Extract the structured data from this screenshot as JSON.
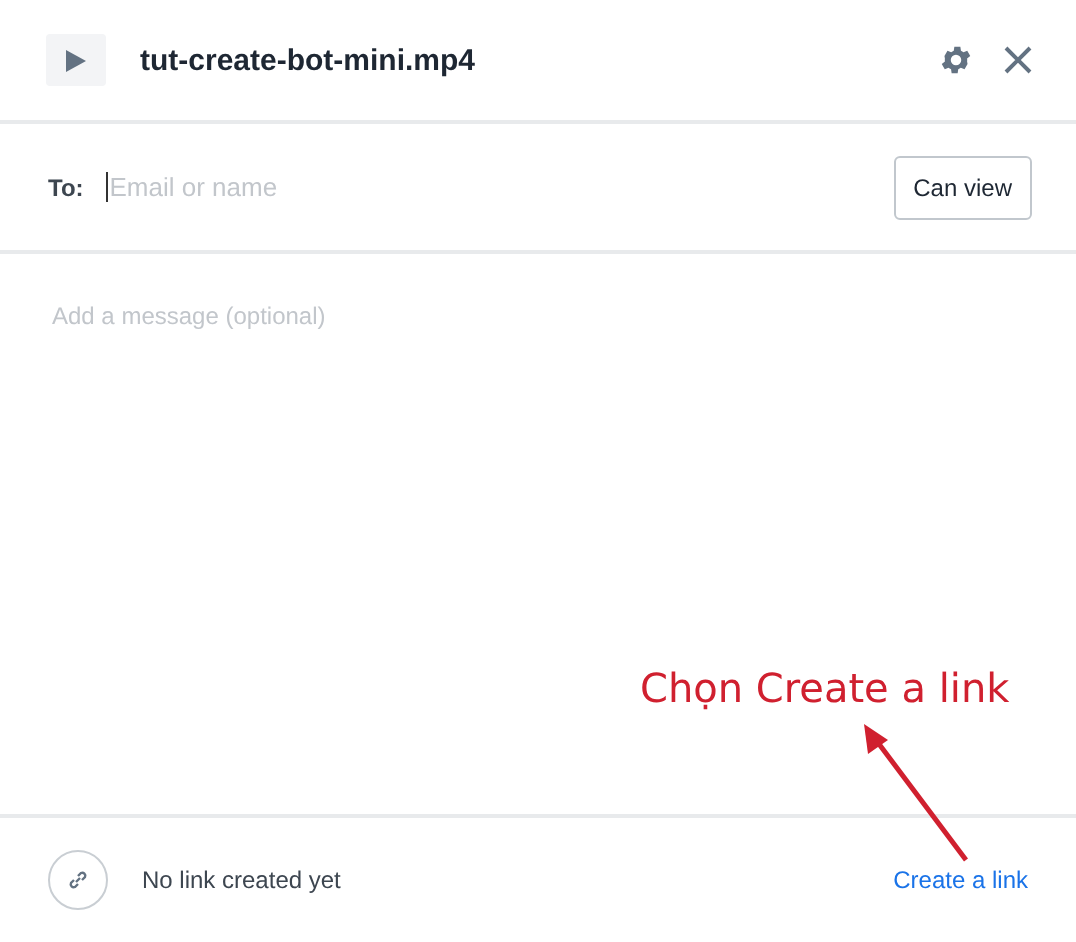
{
  "header": {
    "title": "tut-create-bot-mini.mp4"
  },
  "recipient": {
    "label": "To:",
    "placeholder": "Email or name",
    "permission_button": "Can view"
  },
  "message": {
    "placeholder": "Add a message (optional)"
  },
  "footer": {
    "status": "No link created yet",
    "link": "Create a link"
  },
  "annotation": {
    "text": "Chọn Create a link"
  }
}
